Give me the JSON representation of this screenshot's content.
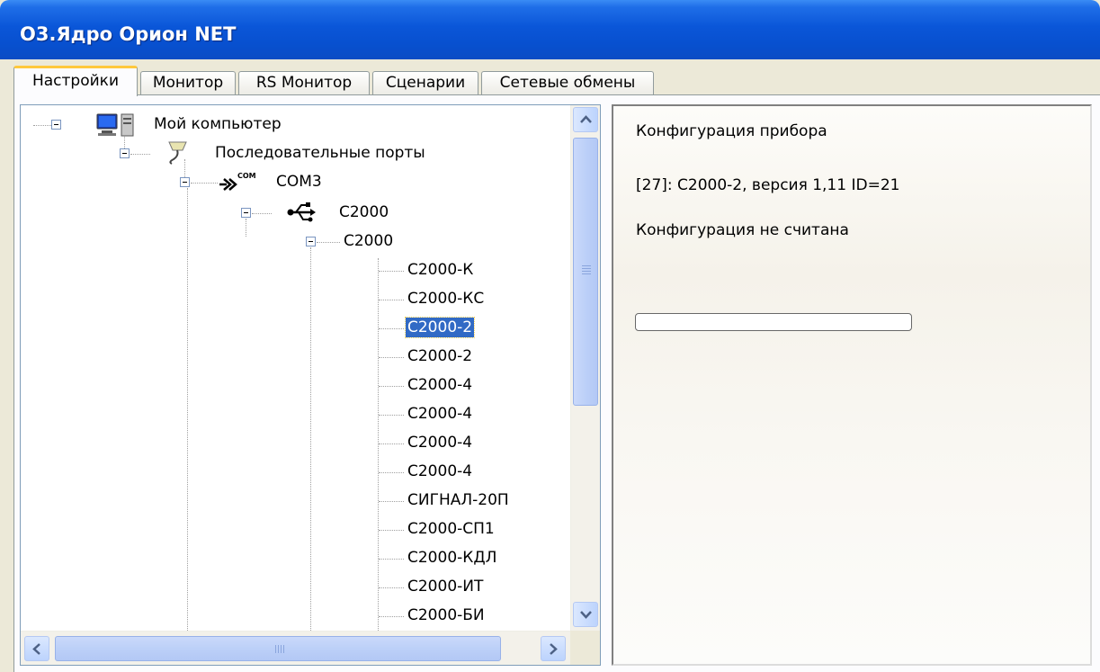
{
  "window": {
    "title": "О3.Ядро Орион NET"
  },
  "tabs": [
    {
      "label": "Настройки",
      "active": true
    },
    {
      "label": "Монитор",
      "active": false
    },
    {
      "label": "RS Монитор",
      "active": false
    },
    {
      "label": "Сценарии",
      "active": false
    },
    {
      "label": "Сетевые обмены",
      "active": false
    }
  ],
  "tree": {
    "root": {
      "label": "Мой компьютер",
      "icon": "computer-icon"
    },
    "ports": {
      "label": "Последовательные порты",
      "icon": "serial-port-icon"
    },
    "com": {
      "label": "COM3",
      "icon": "com-port-icon",
      "badge": "COM"
    },
    "c2000_usb": {
      "label": "С2000",
      "icon": "usb-icon"
    },
    "c2000": {
      "label": "С2000"
    },
    "devices": [
      {
        "label": "С2000-К",
        "selected": false
      },
      {
        "label": "С2000-КС",
        "selected": false
      },
      {
        "label": "С2000-2",
        "selected": true
      },
      {
        "label": "С2000-2",
        "selected": false
      },
      {
        "label": "С2000-4",
        "selected": false
      },
      {
        "label": "С2000-4",
        "selected": false
      },
      {
        "label": "С2000-4",
        "selected": false
      },
      {
        "label": "С2000-4",
        "selected": false
      },
      {
        "label": "СИГНАЛ-20П",
        "selected": false
      },
      {
        "label": "С2000-СП1",
        "selected": false
      },
      {
        "label": "С2000-КДЛ",
        "selected": false
      },
      {
        "label": "С2000-ИТ",
        "selected": false
      },
      {
        "label": "С2000-БИ",
        "selected": false
      }
    ]
  },
  "info_panel": {
    "heading": "Конфигурация прибора",
    "device_line": "[27]: С2000-2, версия 1,11 ID=21",
    "status": "Конфигурация не считана",
    "progress": 0
  },
  "colors": {
    "titlebar": "#0a56d8",
    "selection": "#316ac5",
    "active_tab_accent": "#ffc83c"
  }
}
